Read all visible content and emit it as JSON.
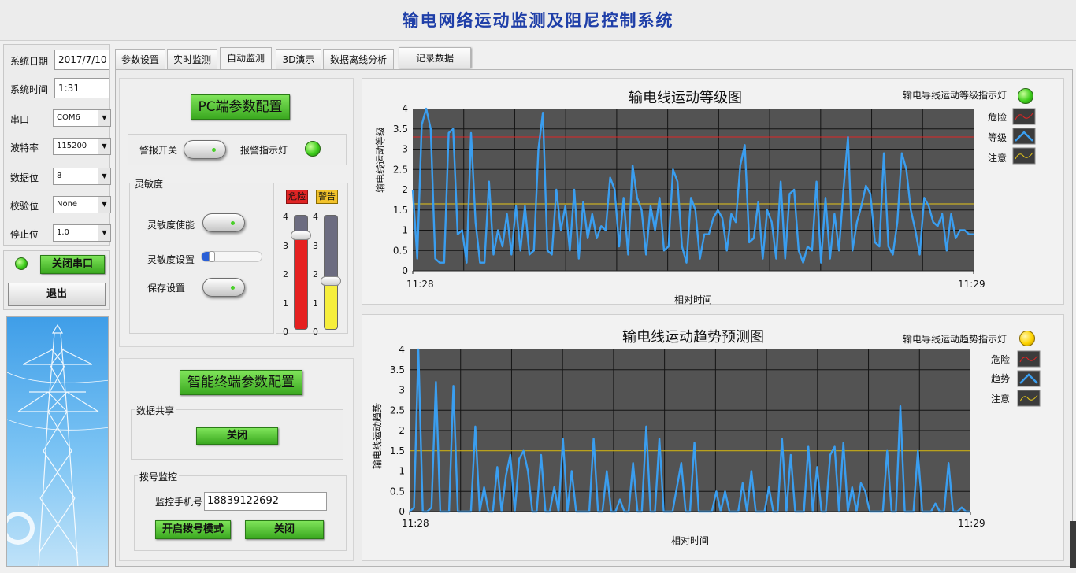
{
  "app": {
    "title": "输电网络运动监测及阻尼控制系统"
  },
  "sidebar": {
    "date_label": "系统日期",
    "date_value": "2017/7/10",
    "time_label": "系统时间",
    "time_value": "1:31",
    "port_label": "串口",
    "port_value": "COM6",
    "baud_label": "波特率",
    "baud_value": "115200",
    "databits_label": "数据位",
    "databits_value": "8",
    "parity_label": "校验位",
    "parity_value": "None",
    "stopbits_label": "停止位",
    "stopbits_value": "1.0",
    "close_port_label": "关闭串口",
    "exit_label": "退出"
  },
  "tabs": [
    {
      "label": "参数设置"
    },
    {
      "label": "实时监测"
    },
    {
      "label": "自动监测"
    },
    {
      "label": "3D演示"
    },
    {
      "label": "数据离线分析"
    },
    {
      "label": "记录数据"
    }
  ],
  "pc_config": {
    "title": "PC端参数配置",
    "alarm_switch_label": "警报开关",
    "alarm_light_label": "报警指示灯",
    "sensitivity_group": "灵敏度",
    "sens_enable_label": "灵敏度使能",
    "sens_setting_label": "灵敏度设置",
    "save_label": "保存设置",
    "sensitivity_level": 0.12,
    "danger_label": "危险",
    "warning_label": "警告",
    "danger_value": 3.3,
    "warning_value": 1.7,
    "meter_max": 4,
    "meter_ticks": [
      "4",
      "3",
      "2",
      "1",
      "0"
    ]
  },
  "terminal_config": {
    "title": "智能终端参数配置",
    "share_group": "数据共享",
    "share_btn": "关闭",
    "dial_group": "拨号监控",
    "phone_label": "监控手机号",
    "phone_value": "18839122692",
    "dial_mode_btn": "开启拨号模式",
    "dial_close_btn": "关闭"
  },
  "colors": {
    "plot_bg": "#535353",
    "series": "#3a9ef0",
    "danger_line": "#e02424",
    "warning_line": "#e6c619",
    "green_button": "#4cc22a",
    "title_blue": "#1f3fa8"
  },
  "chart_data": [
    {
      "type": "line",
      "title": "输电线运动等级图",
      "indicator_label": "输电导线运动等级指示灯",
      "indicator_color": "green",
      "xlabel": "相对时间",
      "ylabel": "输电线运动等级",
      "x_start": "11:28",
      "x_end": "11:29",
      "ylim": [
        0,
        4
      ],
      "yticks": [
        "0",
        "0.5",
        "1",
        "1.5",
        "2",
        "2.5",
        "3",
        "3.5",
        "4"
      ],
      "grid": true,
      "legend_position": "right",
      "danger_level": 3.3,
      "warning_level": 1.65,
      "series": [
        {
          "name": "危险",
          "color": "#e02424"
        },
        {
          "name": "等级",
          "color": "#3a9ef0",
          "values": [
            2.0,
            0.3,
            3.6,
            4.0,
            3.5,
            0.3,
            0.2,
            0.2,
            3.4,
            3.5,
            0.9,
            1.0,
            0.2,
            3.4,
            1.2,
            0.2,
            0.2,
            2.2,
            0.4,
            1.0,
            0.6,
            1.4,
            0.4,
            1.6,
            0.5,
            1.6,
            0.4,
            0.5,
            3.0,
            3.9,
            0.5,
            0.4,
            2.0,
            1.0,
            1.6,
            0.5,
            2.0,
            0.3,
            1.7,
            0.8,
            1.4,
            0.8,
            1.1,
            1.0,
            2.3,
            2.0,
            0.6,
            1.8,
            0.4,
            2.6,
            1.8,
            1.5,
            0.4,
            1.6,
            1.0,
            1.8,
            0.5,
            0.6,
            2.5,
            2.2,
            0.6,
            0.2,
            1.8,
            1.5,
            0.3,
            0.9,
            0.9,
            1.3,
            1.5,
            1.3,
            0.5,
            1.4,
            1.2,
            2.6,
            3.1,
            0.7,
            0.8,
            1.7,
            0.3,
            1.5,
            1.2,
            0.3,
            2.2,
            0.3,
            1.9,
            2.0,
            0.5,
            0.2,
            0.6,
            0.5,
            2.2,
            0.2,
            1.8,
            0.3,
            1.4,
            0.5,
            2.0,
            3.3,
            0.5,
            1.2,
            1.6,
            2.1,
            1.9,
            0.7,
            0.6,
            2.9,
            0.6,
            0.4,
            1.2,
            2.9,
            2.5,
            1.5,
            1.0,
            0.4,
            1.8,
            1.6,
            1.2,
            1.1,
            1.4,
            0.5,
            1.4,
            0.8,
            1.0,
            1.0,
            0.9,
            0.9
          ]
        },
        {
          "name": "注意",
          "color": "#e6c619"
        }
      ]
    },
    {
      "type": "line",
      "title": "输电线运动趋势预测图",
      "indicator_label": "输电导线运动趋势指示灯",
      "indicator_color": "yellow",
      "xlabel": "相对时间",
      "ylabel": "输电线运动趋势",
      "x_start": "11:28",
      "x_end": "11:29",
      "ylim": [
        0,
        4
      ],
      "yticks": [
        "0",
        "0.5",
        "1",
        "1.5",
        "2",
        "2.5",
        "3",
        "3.5",
        "4"
      ],
      "grid": true,
      "legend_position": "right",
      "danger_level": 3.0,
      "warning_level": 1.5,
      "series": [
        {
          "name": "危险",
          "color": "#e02424"
        },
        {
          "name": "趋势",
          "color": "#3a9ef0",
          "values": [
            0.0,
            0.1,
            4.0,
            0.0,
            0.0,
            0.1,
            3.2,
            0.0,
            0.0,
            0.0,
            3.1,
            0.0,
            0.0,
            0.0,
            0.0,
            2.1,
            0.0,
            0.6,
            0.0,
            0.0,
            1.1,
            0.0,
            0.9,
            1.4,
            0.0,
            1.3,
            1.5,
            1.0,
            0.0,
            0.0,
            1.4,
            0.0,
            0.0,
            0.6,
            0.0,
            1.8,
            0.0,
            1.0,
            0.0,
            0.0,
            0.0,
            0.0,
            1.8,
            0.0,
            0.0,
            1.0,
            0.0,
            0.0,
            0.3,
            0.0,
            0.0,
            1.2,
            0.0,
            0.0,
            2.1,
            0.0,
            0.0,
            1.8,
            0.0,
            0.0,
            0.0,
            0.6,
            1.2,
            0.0,
            0.0,
            1.7,
            0.0,
            0.0,
            0.0,
            0.0,
            0.5,
            0.0,
            0.5,
            0.0,
            0.0,
            0.0,
            0.7,
            0.0,
            1.0,
            0.0,
            0.0,
            0.0,
            0.6,
            0.0,
            0.0,
            1.8,
            0.0,
            1.4,
            0.0,
            0.0,
            0.0,
            1.6,
            0.0,
            1.1,
            0.0,
            0.0,
            1.4,
            1.6,
            0.0,
            1.7,
            0.0,
            0.6,
            0.0,
            0.7,
            0.5,
            0.0,
            0.0,
            0.0,
            0.0,
            1.5,
            0.0,
            0.0,
            2.6,
            0.0,
            0.0,
            0.0,
            1.5,
            0.0,
            0.0,
            0.0,
            0.2,
            0.0,
            0.0,
            1.2,
            0.0,
            0.0,
            0.1,
            0.0,
            0.0
          ]
        },
        {
          "name": "注意",
          "color": "#e6c619"
        }
      ]
    }
  ]
}
